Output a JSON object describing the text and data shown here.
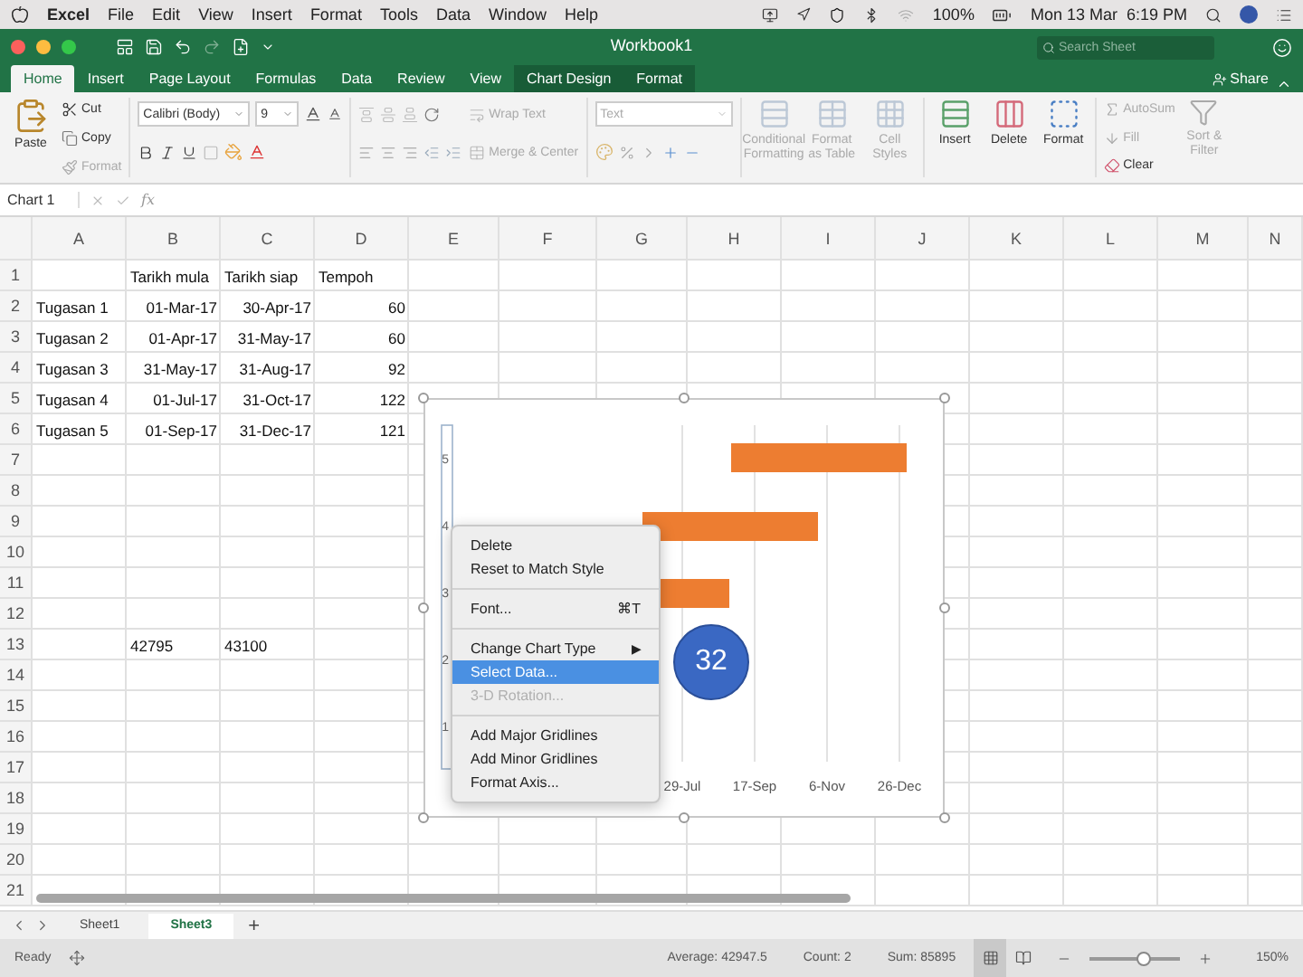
{
  "menu_bar": {
    "app": "Excel",
    "items": [
      "File",
      "Edit",
      "View",
      "Insert",
      "Format",
      "Tools",
      "Data",
      "Window",
      "Help"
    ],
    "battery": "100%",
    "clock": "Mon 13 Mar  6:19 PM"
  },
  "window": {
    "title": "Workbook1",
    "search": {
      "placeholder": "Search Sheet"
    }
  },
  "tabs": [
    {
      "label": "Home",
      "selected": true,
      "kind": "main"
    },
    {
      "label": "Insert",
      "selected": false,
      "kind": "main"
    },
    {
      "label": "Page Layout",
      "selected": false,
      "kind": "main"
    },
    {
      "label": "Formulas",
      "selected": false,
      "kind": "main"
    },
    {
      "label": "Data",
      "selected": false,
      "kind": "main"
    },
    {
      "label": "Review",
      "selected": false,
      "kind": "main"
    },
    {
      "label": "View",
      "selected": false,
      "kind": "main"
    },
    {
      "label": "Chart Design",
      "selected": false,
      "kind": "contextual"
    },
    {
      "label": "Format",
      "selected": false,
      "kind": "contextual"
    }
  ],
  "share": "Share",
  "ribbon": {
    "paste": {
      "label": "Paste",
      "disabled": false
    },
    "cut": {
      "label": "Cut",
      "disabled": false
    },
    "copy": {
      "label": "Copy",
      "disabled": false
    },
    "format_painter": {
      "label": "Format",
      "disabled": true
    },
    "font_name": "Calibri (Body)",
    "font_size": "9",
    "wrap_text": {
      "label": "Wrap Text",
      "disabled": true
    },
    "merge": {
      "label": "Merge & Center",
      "disabled": true
    },
    "number_format": {
      "label": "Text",
      "disabled": true
    },
    "styles": [
      {
        "label": "Conditional Formatting",
        "disabled": true
      },
      {
        "label": "Format as Table",
        "disabled": true
      },
      {
        "label": "Cell Styles",
        "disabled": true
      }
    ],
    "cells": [
      {
        "label": "Insert",
        "disabled": false
      },
      {
        "label": "Delete",
        "disabled": false
      },
      {
        "label": "Format",
        "disabled": false
      }
    ],
    "autosum": {
      "label": "AutoSum",
      "disabled": true
    },
    "fill": {
      "label": "Fill",
      "disabled": true
    },
    "clear": {
      "label": "Clear",
      "disabled": false
    },
    "sort": {
      "label": "Sort & Filter",
      "disabled": true
    }
  },
  "formula_bar": {
    "name_box": "Chart 1",
    "fx": "fx"
  },
  "sheet": {
    "columns": [
      "A",
      "B",
      "C",
      "D",
      "E",
      "F",
      "G",
      "H",
      "I",
      "J",
      "K",
      "L",
      "M",
      "N"
    ],
    "rows": [
      {
        "number": "1",
        "cells": {
          "b": {
            "text": "Tarikh mula",
            "kind": "text"
          },
          "c": {
            "text": "Tarikh siap",
            "kind": "text"
          },
          "d": {
            "text": "Tempoh",
            "kind": "text"
          }
        }
      },
      {
        "number": "2",
        "cells": {
          "a": {
            "text": "Tugasan 1",
            "kind": "text"
          },
          "b": {
            "text": "01-Mar-17",
            "kind": "number"
          },
          "c": {
            "text": "30-Apr-17",
            "kind": "number"
          },
          "d": {
            "text": "60",
            "kind": "number"
          }
        }
      },
      {
        "number": "3",
        "cells": {
          "a": {
            "text": "Tugasan 2",
            "kind": "text"
          },
          "b": {
            "text": "01-Apr-17",
            "kind": "number"
          },
          "c": {
            "text": "31-May-17",
            "kind": "number"
          },
          "d": {
            "text": "60",
            "kind": "number"
          }
        }
      },
      {
        "number": "4",
        "cells": {
          "a": {
            "text": "Tugasan 3",
            "kind": "text"
          },
          "b": {
            "text": "31-May-17",
            "kind": "number"
          },
          "c": {
            "text": "31-Aug-17",
            "kind": "number"
          },
          "d": {
            "text": "92",
            "kind": "number"
          }
        }
      },
      {
        "number": "5",
        "cells": {
          "a": {
            "text": "Tugasan 4",
            "kind": "text"
          },
          "b": {
            "text": "01-Jul-17",
            "kind": "number"
          },
          "c": {
            "text": "31-Oct-17",
            "kind": "number"
          },
          "d": {
            "text": "122",
            "kind": "number"
          }
        }
      },
      {
        "number": "6",
        "cells": {
          "a": {
            "text": "Tugasan 5",
            "kind": "text"
          },
          "b": {
            "text": "01-Sep-17",
            "kind": "number"
          },
          "c": {
            "text": "31-Dec-17",
            "kind": "number"
          },
          "d": {
            "text": "121",
            "kind": "number"
          }
        }
      },
      {
        "number": "7",
        "cells": {}
      },
      {
        "number": "8",
        "cells": {}
      },
      {
        "number": "9",
        "cells": {}
      },
      {
        "number": "10",
        "cells": {}
      },
      {
        "number": "11",
        "cells": {}
      },
      {
        "number": "12",
        "cells": {}
      },
      {
        "number": "13",
        "cells": {
          "b": {
            "text": "42795",
            "kind": "text"
          },
          "c": {
            "text": "43100",
            "kind": "text"
          }
        }
      },
      {
        "number": "14",
        "cells": {}
      },
      {
        "number": "15",
        "cells": {}
      },
      {
        "number": "16",
        "cells": {}
      },
      {
        "number": "17",
        "cells": {}
      },
      {
        "number": "18",
        "cells": {}
      },
      {
        "number": "19",
        "cells": {}
      },
      {
        "number": "20",
        "cells": {}
      },
      {
        "number": "21",
        "cells": {}
      }
    ]
  },
  "chart": {
    "y_labels": [
      "5",
      "4",
      "3",
      "2",
      "1"
    ],
    "x_labels": [
      "29-Jul",
      "17-Sep",
      "6-Nov",
      "26-Dec"
    ]
  },
  "context_menu": {
    "items": [
      {
        "kind": "item",
        "label": "Delete",
        "selected": false,
        "disabled": false
      },
      {
        "kind": "item",
        "label": "Reset to Match Style",
        "selected": false,
        "disabled": false
      },
      {
        "kind": "separator"
      },
      {
        "kind": "item",
        "label": "Font...",
        "shortcut": "⌘T",
        "selected": false,
        "disabled": false
      },
      {
        "kind": "separator"
      },
      {
        "kind": "submenu",
        "label": "Change Chart Type",
        "arrow": "▶",
        "selected": false,
        "disabled": false
      },
      {
        "kind": "item",
        "label": "Select Data...",
        "selected": true,
        "disabled": false
      },
      {
        "kind": "item",
        "label": "3-D Rotation...",
        "selected": false,
        "disabled": true
      },
      {
        "kind": "separator"
      },
      {
        "kind": "item",
        "label": "Add Major Gridlines",
        "selected": false,
        "disabled": false
      },
      {
        "kind": "item",
        "label": "Add Minor Gridlines",
        "selected": false,
        "disabled": false
      },
      {
        "kind": "item",
        "label": "Format Axis...",
        "selected": false,
        "disabled": false
      }
    ]
  },
  "step_badge": "32",
  "sheet_tabs": {
    "tabs": [
      {
        "label": "Sheet1",
        "selected": false
      },
      {
        "label": "Sheet3",
        "selected": true
      }
    ],
    "add": "+"
  },
  "status_bar": {
    "mode": "Ready",
    "average": "Average: 42947.5",
    "count": "Count: 2",
    "sum": "Sum: 85895",
    "views": [
      {
        "selected": true
      },
      {
        "selected": false
      }
    ],
    "zoom": {
      "level": 0.6,
      "reading": "150%"
    }
  }
}
